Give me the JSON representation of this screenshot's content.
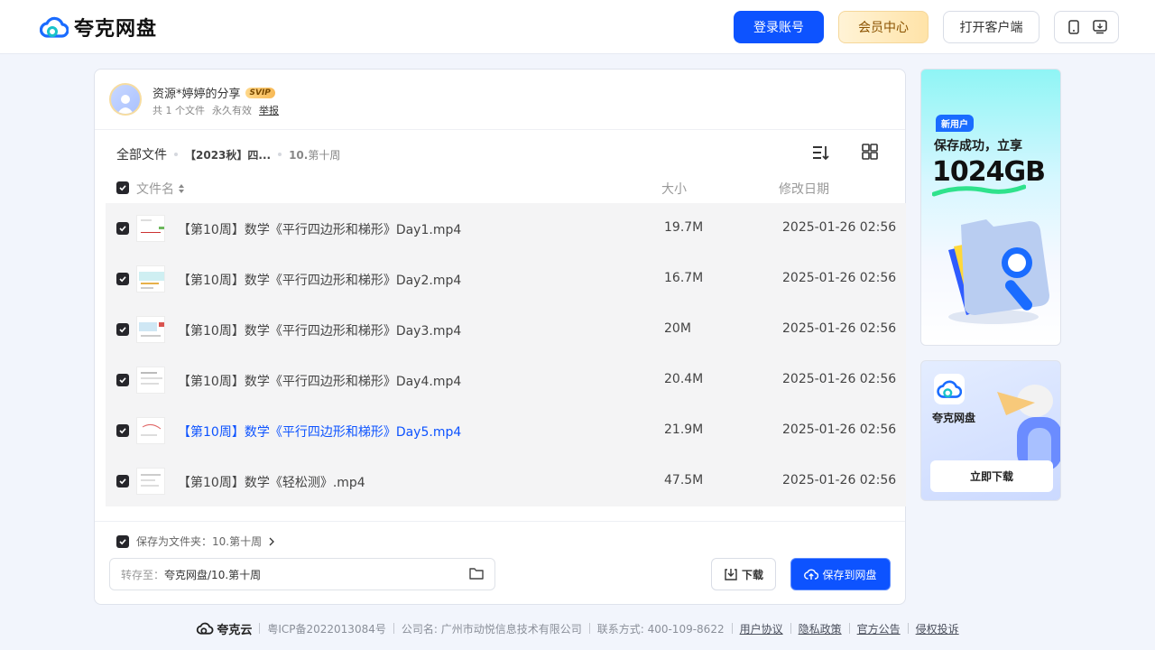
{
  "brand": {
    "name": "夸克网盘"
  },
  "header": {
    "login_label": "登录账号",
    "vip_label": "会员中心",
    "client_label": "打开客户端"
  },
  "share": {
    "owner": "资源*婷婷的分享",
    "badge": "SVIP",
    "file_count": "共 1 个文件",
    "validity": "永久有效",
    "report_label": "举报"
  },
  "breadcrumb": {
    "root": "全部文件",
    "mid": "【2023秋】四...",
    "current_prefix": "10.",
    "current_name": "第十周"
  },
  "table": {
    "headers": {
      "name": "文件名",
      "size": "大小",
      "date": "修改日期"
    },
    "rows": [
      {
        "name": "【第10周】数学《平行四边形和梯形》Day1.mp4",
        "size": "19.7M",
        "date": "2025-01-26 02:56"
      },
      {
        "name": "【第10周】数学《平行四边形和梯形》Day2.mp4",
        "size": "16.7M",
        "date": "2025-01-26 02:56"
      },
      {
        "name": "【第10周】数学《平行四边形和梯形》Day3.mp4",
        "size": "20M",
        "date": "2025-01-26 02:56"
      },
      {
        "name": "【第10周】数学《平行四边形和梯形》Day4.mp4",
        "size": "20.4M",
        "date": "2025-01-26 02:56"
      },
      {
        "name": "【第10周】数学《平行四边形和梯形》Day5.mp4",
        "size": "21.9M",
        "date": "2025-01-26 02:56"
      },
      {
        "name": "【第10周】数学《轻松测》.mp4",
        "size": "47.5M",
        "date": "2025-01-26 02:56"
      }
    ]
  },
  "save": {
    "save_as_label": "保存为文件夹：10.第十周",
    "path_label": "转存至：",
    "path_value": "夸克网盘/10.第十周",
    "download_label": "下载",
    "save_label": "保存到网盘"
  },
  "ad1": {
    "tag": "新用户",
    "line": "保存成功，立享",
    "big": "1024GB"
  },
  "ad2": {
    "name": "夸克网盘",
    "button": "立即下载"
  },
  "footer": {
    "logo": "夸克云",
    "icp": "粤ICP备2022013084号",
    "company": "公司名: 广州市动悦信息技术有限公司",
    "contact": "联系方式: 400-109-8622",
    "links": [
      "用户协议",
      "隐私政策",
      "官方公告",
      "侵权投诉"
    ]
  },
  "colors": {
    "primary": "#0d53ff",
    "active_text": "#0d53ff",
    "row_bg": "#f4f4f5"
  }
}
